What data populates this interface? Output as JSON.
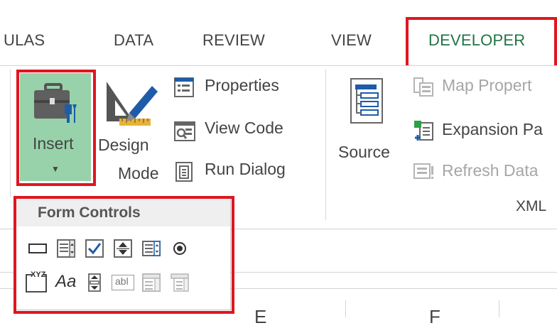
{
  "tabs": [
    {
      "label": "ULAS",
      "active": false
    },
    {
      "label": "DATA",
      "active": false
    },
    {
      "label": "REVIEW",
      "active": false
    },
    {
      "label": "VIEW",
      "active": false
    },
    {
      "label": "DEVELOPER",
      "active": true
    }
  ],
  "ribbon": {
    "insert": {
      "label": "Insert"
    },
    "design_mode": {
      "label_line1": "Design",
      "label_line2": "Mode"
    },
    "properties": {
      "label": "Properties"
    },
    "view_code": {
      "label": "View Code"
    },
    "run_dialog": {
      "label": "Run Dialog"
    },
    "source": {
      "label": "Source"
    },
    "map_properties": {
      "label": "Map Propert",
      "enabled": false
    },
    "expansion_packs": {
      "label": "Expansion Pa",
      "enabled": true
    },
    "refresh_data": {
      "label": "Refresh Data",
      "enabled": false
    },
    "xml_group": {
      "label": "XML"
    }
  },
  "form_controls": {
    "heading": "Form Controls",
    "row1": [
      "button-control-icon",
      "combo-box-icon",
      "check-box-icon",
      "spin-button-icon",
      "list-box-icon",
      "option-button-icon"
    ],
    "row2": [
      "group-box-icon",
      "label-icon",
      "scroll-bar-icon",
      "text-field-icon",
      "combo-list-edit-icon",
      "combo-drop-down-edit-icon"
    ],
    "group_box_text": "XYZ",
    "label_text": "Aa",
    "text_field_text": "abl"
  },
  "sheet": {
    "col_letters": [
      "E",
      "F"
    ]
  },
  "colors": {
    "accent_green": "#217346",
    "highlight_red": "#e0161f",
    "insert_bg": "#98d2aa",
    "check_blue": "#1e5ca8"
  }
}
